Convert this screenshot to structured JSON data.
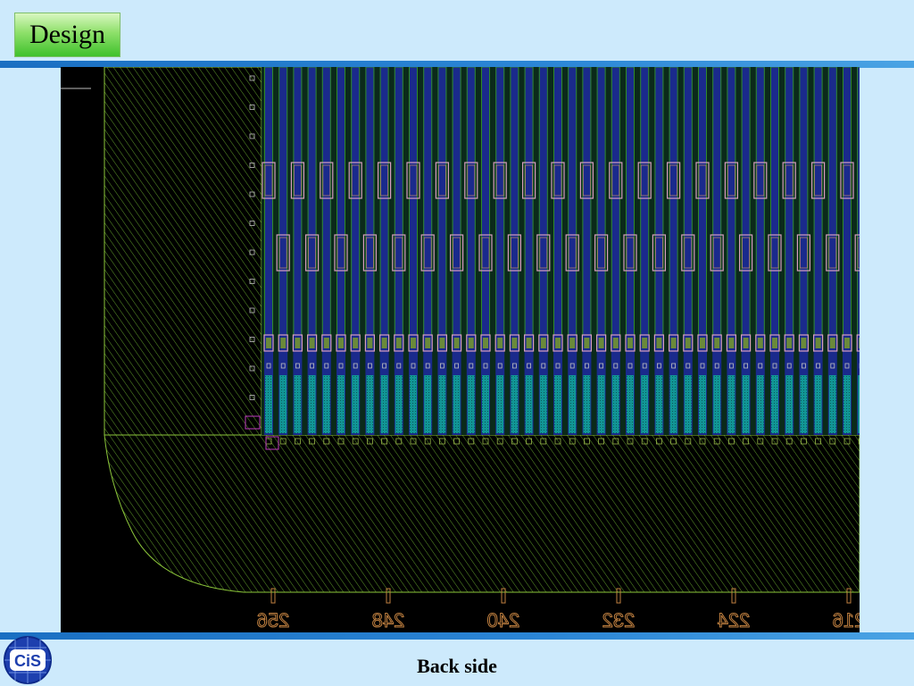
{
  "slide": {
    "title": "Design",
    "caption": "Back side",
    "logo_text": "CiS"
  },
  "layout": {
    "scale_labels": [
      "256",
      "248",
      "240",
      "232",
      "224",
      "216"
    ],
    "colors": {
      "background": "#000000",
      "hatch": "#7ab83a",
      "outline": "#a8d83a",
      "strip_teal": "#1aa0a0",
      "strip_blue": "#1a2a8c",
      "pad_pink": "#d8a0c0",
      "pad_orange": "#d09050",
      "label": "#c08040"
    }
  },
  "theme": {
    "slide_background": "#cdeafc",
    "band": "#2b86d6"
  }
}
